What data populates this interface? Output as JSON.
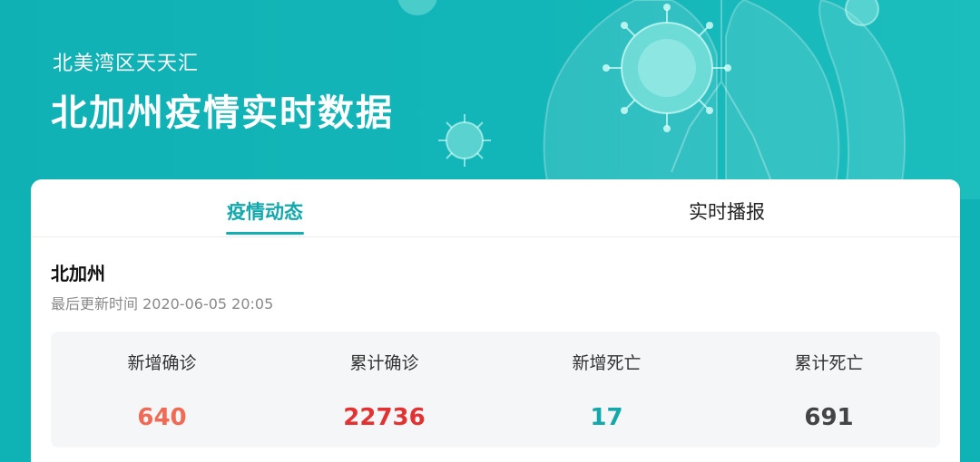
{
  "header": {
    "subtitle": "北美湾区天天汇",
    "title": "北加州疫情实时数据"
  },
  "tabs": [
    {
      "label": "疫情动态",
      "active": true
    },
    {
      "label": "实时播报",
      "active": false
    }
  ],
  "region": {
    "name": "北加州",
    "updated": "最后更新时间 2020-06-05 20:05"
  },
  "stats": [
    {
      "label": "新增确诊",
      "value": "640",
      "color": "#f06a55"
    },
    {
      "label": "累计确诊",
      "value": "22736",
      "color": "#e33232"
    },
    {
      "label": "新增死亡",
      "value": "17",
      "color": "#14a8ab"
    },
    {
      "label": "累计死亡",
      "value": "691",
      "color": "#444444"
    }
  ],
  "theme": {
    "accent": "#13b0b3",
    "background": "#0fb3b6"
  }
}
